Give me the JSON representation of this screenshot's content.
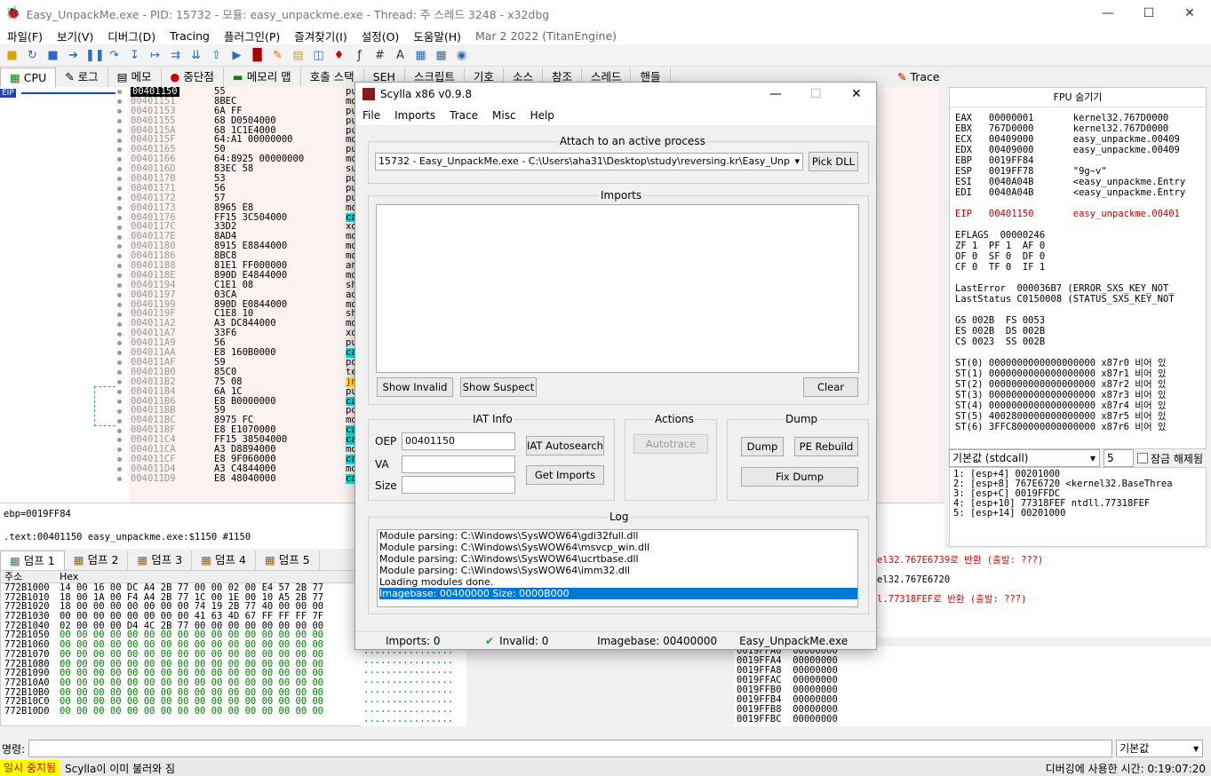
{
  "window": {
    "title": "Easy_UnpackMe.exe - PID: 15732 - 모듈: easy_unpackme.exe - Thread: 주 스레드 3248 - x32dbg"
  },
  "menu": [
    "파일(F)",
    "보기(V)",
    "디버그(D)",
    "Tracing",
    "플러그인(P)",
    "즐겨찾기(I)",
    "설정(O)",
    "도움말(H)"
  ],
  "menu_info": "Mar 2 2022 (TitanEngine)",
  "tabs": [
    "CPU",
    "로그",
    "메모",
    "중단점",
    "메모리 맵",
    "호출 스택",
    "SEH",
    "스크립트",
    "기호",
    "소스",
    "참조",
    "스레드",
    "핸들"
  ],
  "right_tab": "Trace",
  "eip_label": "EIP",
  "disasm": [
    {
      "addr": "00401150",
      "bytes": "55",
      "instr": "pu"
    },
    {
      "addr": "00401151",
      "bytes": "8BEC",
      "instr": "mo"
    },
    {
      "addr": "00401153",
      "bytes": "6A FF",
      "instr": "pu"
    },
    {
      "addr": "00401155",
      "bytes": "68 D0504000",
      "instr": "pu"
    },
    {
      "addr": "0040115A",
      "bytes": "68 1C1E4000",
      "instr": "pu"
    },
    {
      "addr": "0040115F",
      "bytes": "64:A1 00000000",
      "instr": "mo"
    },
    {
      "addr": "00401165",
      "bytes": "50",
      "instr": "pu"
    },
    {
      "addr": "00401166",
      "bytes": "64:8925 00000000",
      "instr": "mo"
    },
    {
      "addr": "0040116D",
      "bytes": "83EC 58",
      "instr": "su"
    },
    {
      "addr": "00401170",
      "bytes": "53",
      "instr": "pu"
    },
    {
      "addr": "00401171",
      "bytes": "56",
      "instr": "pu"
    },
    {
      "addr": "00401172",
      "bytes": "57",
      "instr": "pu"
    },
    {
      "addr": "00401173",
      "bytes": "8965 E8",
      "instr": "mo"
    },
    {
      "addr": "00401176",
      "bytes": "FF15 3C504000",
      "instr": "ca",
      "call": true
    },
    {
      "addr": "0040117C",
      "bytes": "33D2",
      "instr": "xo"
    },
    {
      "addr": "0040117E",
      "bytes": "8AD4",
      "instr": "mo"
    },
    {
      "addr": "00401180",
      "bytes": "8915 E8844000",
      "instr": "mo"
    },
    {
      "addr": "00401186",
      "bytes": "8BC8",
      "instr": "mo"
    },
    {
      "addr": "00401188",
      "bytes": "81E1 FF000000",
      "instr": "an"
    },
    {
      "addr": "0040118E",
      "bytes": "890D E4844000",
      "instr": "mo"
    },
    {
      "addr": "00401194",
      "bytes": "C1E1 08",
      "instr": "sh"
    },
    {
      "addr": "00401197",
      "bytes": "03CA",
      "instr": "ad"
    },
    {
      "addr": "00401199",
      "bytes": "890D E0844000",
      "instr": "mo"
    },
    {
      "addr": "0040119F",
      "bytes": "C1E8 10",
      "instr": "sh"
    },
    {
      "addr": "004011A2",
      "bytes": "A3 DC844000",
      "instr": "mo"
    },
    {
      "addr": "004011A7",
      "bytes": "33F6",
      "instr": "xo"
    },
    {
      "addr": "004011A9",
      "bytes": "56",
      "instr": "pu"
    },
    {
      "addr": "004011AA",
      "bytes": "E8 160B0000",
      "instr": "ca",
      "call": true
    },
    {
      "addr": "004011AF",
      "bytes": "59",
      "instr": "po"
    },
    {
      "addr": "004011B0",
      "bytes": "85C0",
      "instr": "te"
    },
    {
      "addr": "004011B2",
      "bytes": "75 08",
      "instr": "jn"
    },
    {
      "addr": "004011B4",
      "bytes": "6A 1C",
      "instr": "pu"
    },
    {
      "addr": "004011B6",
      "bytes": "E8 B0000000",
      "instr": "ca",
      "call": true
    },
    {
      "addr": "004011BB",
      "bytes": "59",
      "instr": "po"
    },
    {
      "addr": "004011BC",
      "bytes": "8975 FC",
      "instr": "mo"
    },
    {
      "addr": "004011BF",
      "bytes": "E8 E1070000",
      "instr": "ca",
      "call": true
    },
    {
      "addr": "004011C4",
      "bytes": "FF15 38504000",
      "instr": "ca",
      "call": true
    },
    {
      "addr": "004011CA",
      "bytes": "A3 D8894000",
      "instr": "mo"
    },
    {
      "addr": "004011CF",
      "bytes": "E8 9F060000",
      "instr": "ca",
      "call": true
    },
    {
      "addr": "004011D4",
      "bytes": "A3 C4844000",
      "instr": "mo"
    },
    {
      "addr": "004011D9",
      "bytes": "E8 48040000",
      "instr": "ca",
      "call": true
    }
  ],
  "regs": {
    "header": "FPU 숨기기",
    "lines": [
      "EAX   00000001       kernel32.767D0000",
      "EBX   767D0000       kernel32.767D0000",
      "ECX   00409000       easy_unpackme.00409",
      "EDX   00409000       easy_unpackme.00409",
      "EBP   0019FF84",
      "ESP   0019FF78       \"9g~v\"",
      "ESI   0040A04B       <easy_unpackme.Entry",
      "EDI   0040A04B       <easy_unpackme.Entry",
      "",
      "EIP   00401150       easy_unpackme.00401",
      "",
      "EFLAGS  00000246",
      "ZF 1  PF 1  AF 0",
      "OF 0  SF 0  DF 0",
      "CF 0  TF 0  IF 1",
      "",
      "LastError  000036B7 (ERROR_SXS_KEY_NOT_",
      "LastStatus C0150008 (STATUS_SXS_KEY_NOT",
      "",
      "GS 002B  FS 0053",
      "ES 002B  DS 002B",
      "CS 0023  SS 002B",
      "",
      "ST(0) 0000000000000000000 x87r0 비어 있",
      "ST(1) 0000000000000000000 x87r1 비어 있",
      "ST(2) 0000000000000000000 x87r2 비어 있",
      "ST(3) 0000000000000000000 x87r3 비어 있",
      "ST(4) 0000000000000000000 x87r4 비어 있",
      "ST(5) 4002800000000000000 x87r5 비어 있",
      "ST(6) 3FFC800000000000000 x87r6 비어 있"
    ]
  },
  "callconv": {
    "value": "기본값 (stdcall)",
    "count": "5",
    "lock": "잠금 해제됨"
  },
  "args": [
    "1: [esp+4] 00201000",
    "2: [esp+8] 767E6720 <kernel32.BaseThrea",
    "3: [esp+C] 0019FFDC",
    "4: [esp+10] 77318FEF ntdll.77318FEF",
    "5: [esp+14] 00201000"
  ],
  "info": {
    "line1": "ebp=0019FF84",
    "line2": ".text:00401150 easy_unpackme.exe:$1150 #1150"
  },
  "dump_tabs": [
    "덤프 1",
    "덤프 2",
    "덤프 3",
    "덤프 4",
    "덤프 5"
  ],
  "dump_head": {
    "addr": "주소",
    "hex": "Hex"
  },
  "dump": [
    {
      "a": "772B1000",
      "h": "14 00 16 00 DC A4 2B 77 00 00 02 00 E4 57 2B 77"
    },
    {
      "a": "772B1010",
      "h": "18 00 1A 00 F4 A4 2B 77 1C 00 1E 00 10 A5 2B 77"
    },
    {
      "a": "772B1020",
      "h": "18 00 00 00 00 00 00 00 74 19 2B 77 40 00 00 00"
    },
    {
      "a": "772B1030",
      "h": "00 00 00 00 00 00 00 00 41 63 4D 67 FF FF FF 7F"
    },
    {
      "a": "772B1040",
      "h": "02 00 00 00 D4 4C 2B 77 00 00 00 00 00 00 00 00"
    },
    {
      "a": "772B1050",
      "h": "00 00 00 00 00 00 00 00 00 00 00 00 00 00 00 00"
    },
    {
      "a": "772B1060",
      "h": "00 00 00 00 00 00 00 00 00 00 00 00 00 00 00 00"
    },
    {
      "a": "772B1070",
      "h": "00 00 00 00 00 00 00 00 00 00 00 00 00 00 00 00"
    },
    {
      "a": "772B1080",
      "h": "00 00 00 00 00 00 00 00 00 00 00 00 00 00 00 00"
    },
    {
      "a": "772B1090",
      "h": "00 00 00 00 00 00 00 00 00 00 00 00 00 00 00 00"
    },
    {
      "a": "772B10A0",
      "h": "00 00 00 00 00 00 00 00 00 00 00 00 00 00 00 00"
    },
    {
      "a": "772B10B0",
      "h": "00 00 00 00 00 00 00 00 00 00 00 00 00 00 00 00"
    },
    {
      "a": "772B10C0",
      "h": "00 00 00 00 00 00 00 00 00 00 00 00 00 00 00 00"
    },
    {
      "a": "772B10D0",
      "h": "00 00 00 00 00 00 00 00 00 00 00 00 00 00 00 00"
    }
  ],
  "ascii_rows": "................\n................\n................\n................\n................\n................\n................\n................",
  "callstack": [
    "el32.767E6739로 반환 (출발: ???)",
    "el32.767E6720",
    "l.77318FEF로 반환 (출발: ???)"
  ],
  "stack": [
    "0019FFA0  00000000",
    "0019FFA4  00000000",
    "0019FFA8  00000000",
    "0019FFAC  00000000",
    "0019FFB0  00000000",
    "0019FFB4  00000000",
    "0019FFB8  00000000",
    "0019FFBC  00000000"
  ],
  "cmd": {
    "label": "명령:",
    "default": "기본값"
  },
  "status": {
    "paused": "일시 중지됨",
    "message": "Scylla이 이미 불러와 짐",
    "time": "디버깅에 사용한 시간: 0:19:07:20"
  },
  "scylla": {
    "title": "Scylla x86 v0.9.8",
    "menu": [
      "File",
      "Imports",
      "Trace",
      "Misc",
      "Help"
    ],
    "attach_label": "Attach to an active process",
    "process": "15732 - Easy_UnpackMe.exe - C:\\Users\\aha31\\Desktop\\study\\reversing.kr\\Easy_Unp",
    "pick_dll": "Pick DLL",
    "imports_label": "Imports",
    "show_invalid": "Show Invalid",
    "show_suspect": "Show Suspect",
    "clear": "Clear",
    "iat_label": "IAT Info",
    "oep_label": "OEP",
    "oep": "00401150",
    "va_label": "VA",
    "size_label": "Size",
    "iat_autosearch": "IAT Autosearch",
    "get_imports": "Get Imports",
    "actions_label": "Actions",
    "autotrace": "Autotrace",
    "dump_label": "Dump",
    "dump_btn": "Dump",
    "pe_rebuild": "PE Rebuild",
    "fix_dump": "Fix Dump",
    "log_label": "Log",
    "log": [
      "Module parsing: C:\\Windows\\SysWOW64\\gdi32full.dll",
      "Module parsing: C:\\Windows\\SysWOW64\\msvcp_win.dll",
      "Module parsing: C:\\Windows\\SysWOW64\\ucrtbase.dll",
      "Module parsing: C:\\Windows\\SysWOW64\\imm32.dll",
      "Loading modules done.",
      "Imagebase: 00400000 Size: 0000B000"
    ],
    "status_imports": "Imports: 0",
    "status_invalid": "Invalid: 0",
    "status_imagebase": "Imagebase: 00400000",
    "status_module": "Easy_UnpackMe.exe"
  }
}
